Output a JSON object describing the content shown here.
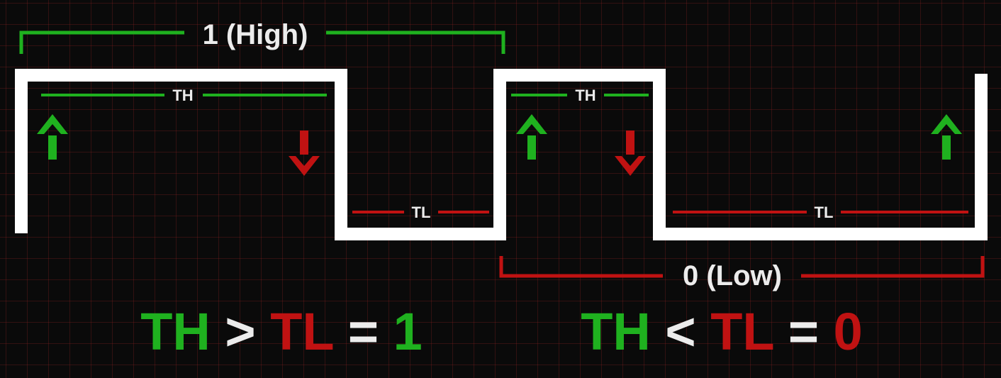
{
  "labels": {
    "high": "1 (High)",
    "low": "0 (Low)",
    "th": "TH",
    "tl": "TL"
  },
  "equations": {
    "left": {
      "a": "TH",
      "op": ">",
      "b": "TL",
      "eq": "=",
      "result": "1"
    },
    "right": {
      "a": "TH",
      "op": "<",
      "b": "TL",
      "eq": "=",
      "result": "0"
    }
  },
  "colors": {
    "background": "#0a0a0a",
    "grid": "#7a1e1e",
    "waveform": "#ffffff",
    "green": "#1fb11f",
    "red": "#c01212",
    "label_text": "#ececec"
  },
  "icons": {
    "up_arrow": "arrow-up-icon",
    "down_arrow": "arrow-down-icon"
  }
}
